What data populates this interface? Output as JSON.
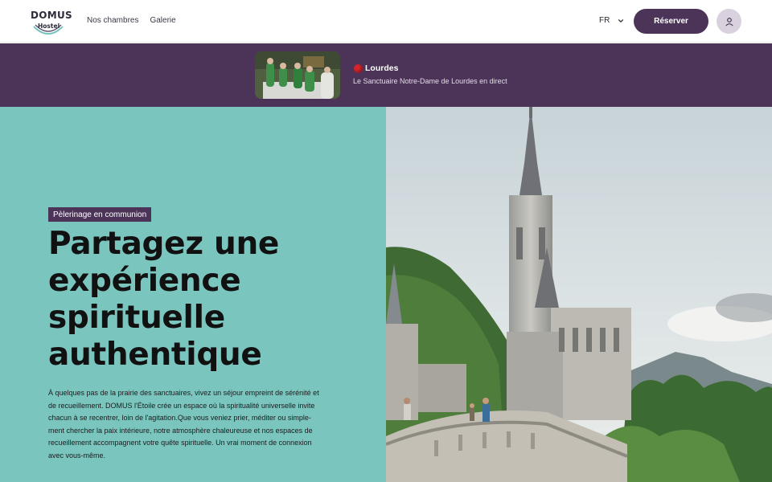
{
  "header": {
    "logo_main": "DOMUS",
    "logo_sub": "Hostel",
    "nav": [
      {
        "label": "Nos chambres"
      },
      {
        "label": "Galerie"
      }
    ],
    "language": "FR",
    "reserve_label": "Réserver"
  },
  "banner": {
    "title": "Lourdes",
    "subtitle": "Le Sanctuaire Notre-Dame de Lourdes en direct"
  },
  "hero": {
    "tag": "Pèlerinage en communion",
    "title_lines": [
      "Partagez une",
      "expérience",
      "spirituelle",
      "authentique"
    ],
    "text_lines": [
      "À quelques pas de la prairie des sanctuaires, vivez un séjour empreint de sérénité et",
      "de recueillement. DOMUS l'Étoile crée un espace où la spiritualité universelle invite",
      "chacun à se recentrer, loin de l'agitation.Que vous veniez prier, méditer ou simple-",
      "ment chercher la paix intérieure, notre atmosphère chaleureuse et nos espaces de",
      "recueillement accompagnent votre quête spirituelle. Un vrai moment de connexion",
      "avec vous-même."
    ]
  },
  "colors": {
    "brand_purple": "#4b3458",
    "hero_teal": "#7bc5bf",
    "live_red": "#d6252c"
  },
  "icons": {
    "language_chevron": "chevron-down-icon",
    "user": "user-icon",
    "live": "live-dot-icon"
  }
}
